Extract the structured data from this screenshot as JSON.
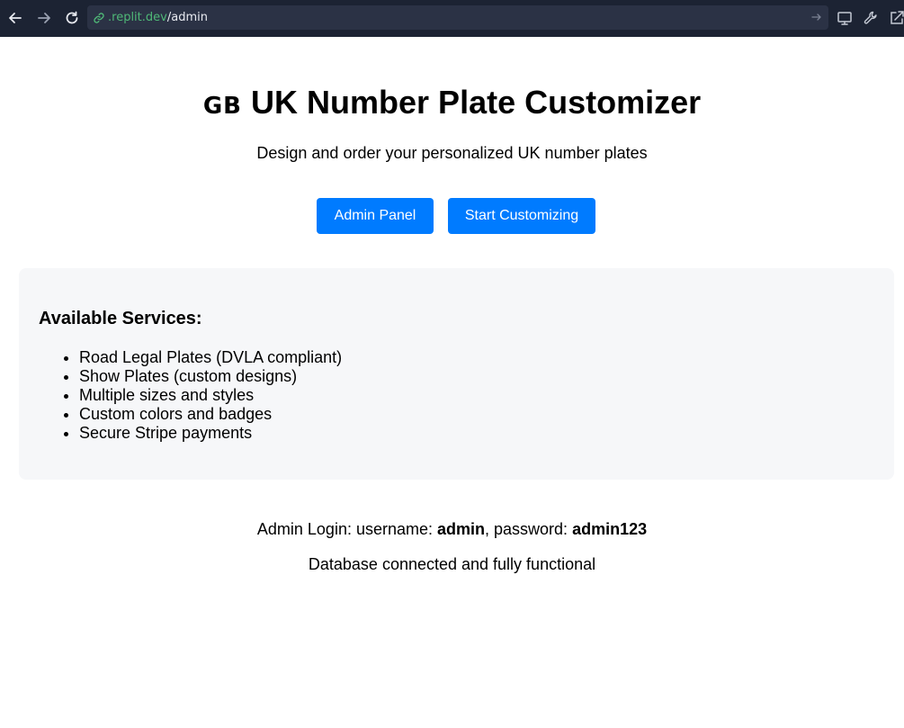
{
  "browser": {
    "url_domain": ".replit.dev",
    "url_path": "/admin",
    "icons": [
      "back-arrow-icon",
      "forward-arrow-icon",
      "reload-icon",
      "link-icon",
      "go-arrow-icon",
      "monitor-icon",
      "wrench-icon",
      "external-link-icon"
    ]
  },
  "header": {
    "flag_text": "GB",
    "title": "UK Number Plate Customizer",
    "subtitle": "Design and order your personalized UK number plates"
  },
  "actions": {
    "admin_label": "Admin Panel",
    "start_label": "Start Customizing",
    "accent_color": "#007bff"
  },
  "services": {
    "heading": "Available Services:",
    "items": [
      "Road Legal Plates (DVLA compliant)",
      "Show Plates (custom designs)",
      "Multiple sizes and styles",
      "Custom colors and badges",
      "Secure Stripe payments"
    ]
  },
  "footer": {
    "login_prefix": "Admin Login: username: ",
    "username": "admin",
    "password_prefix": ", password: ",
    "password": "admin123",
    "status": "Database connected and fully functional"
  }
}
